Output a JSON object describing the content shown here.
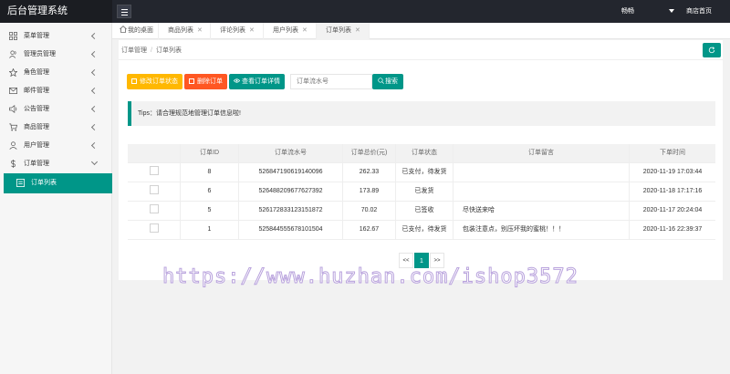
{
  "app": {
    "title": "后台管理系统"
  },
  "header": {
    "username": "畅畅",
    "home_link": "商店首页"
  },
  "sidebar": {
    "items": [
      {
        "label": "菜单管理",
        "icon": "grid-icon"
      },
      {
        "label": "管理员管理",
        "icon": "users-icon"
      },
      {
        "label": "角色管理",
        "icon": "star-icon"
      },
      {
        "label": "邮件管理",
        "icon": "mail-icon"
      },
      {
        "label": "公告管理",
        "icon": "speaker-icon"
      },
      {
        "label": "商品管理",
        "icon": "cart-icon"
      },
      {
        "label": "用户管理",
        "icon": "user-icon"
      },
      {
        "label": "订单管理",
        "icon": "dollar-icon"
      }
    ],
    "active_sub_item": {
      "label": "订单列表",
      "icon": "order-icon"
    }
  },
  "tabs": [
    {
      "label": "我的桌面",
      "icon": "home-icon"
    },
    {
      "label": "商品列表"
    },
    {
      "label": "评论列表"
    },
    {
      "label": "用户列表"
    },
    {
      "label": "订单列表"
    }
  ],
  "breadcrumb": {
    "parent": "订单管理",
    "separator": "/",
    "current": "订单列表"
  },
  "toolbar": {
    "edit_status_label": "修改订单状态",
    "delete_label": "删除订单",
    "view_detail_label": "查看订单详情",
    "search_placeholder": "订单流水号",
    "search_label": "搜索"
  },
  "tips": "Tips：请合理规范地管理订单信息啦!",
  "table": {
    "headers": [
      "",
      "订单ID",
      "订单流水号",
      "订单总价(元)",
      "订单状态",
      "订单留言",
      "下单时间"
    ],
    "rows": [
      {
        "id": "8",
        "serial": "526847190619140096",
        "total": "262.33",
        "status": "已支付，待发货",
        "note": "",
        "time": "2020-11-19 17:03:44"
      },
      {
        "id": "6",
        "serial": "526488209677627392",
        "total": "173.89",
        "status": "已发货",
        "note": "",
        "time": "2020-11-18 17:17:16"
      },
      {
        "id": "5",
        "serial": "526172833123151872",
        "total": "70.02",
        "status": "已签收",
        "note": "尽快送来哈",
        "time": "2020-11-17 20:24:04"
      },
      {
        "id": "1",
        "serial": "525844555678101504",
        "total": "162.67",
        "status": "已支付，待发货",
        "note": "包装注意点，别压坏我的蜜桃！！！",
        "time": "2020-11-16 22:39:37"
      }
    ]
  },
  "pagination": {
    "prev": "<<",
    "current": "1",
    "next": ">>"
  },
  "watermark": "https://www.huzhan.com/ishop3572",
  "colors": {
    "accent": "#009688",
    "warning": "#ffb800",
    "danger": "#ff5722",
    "topbar": "#23262e"
  }
}
